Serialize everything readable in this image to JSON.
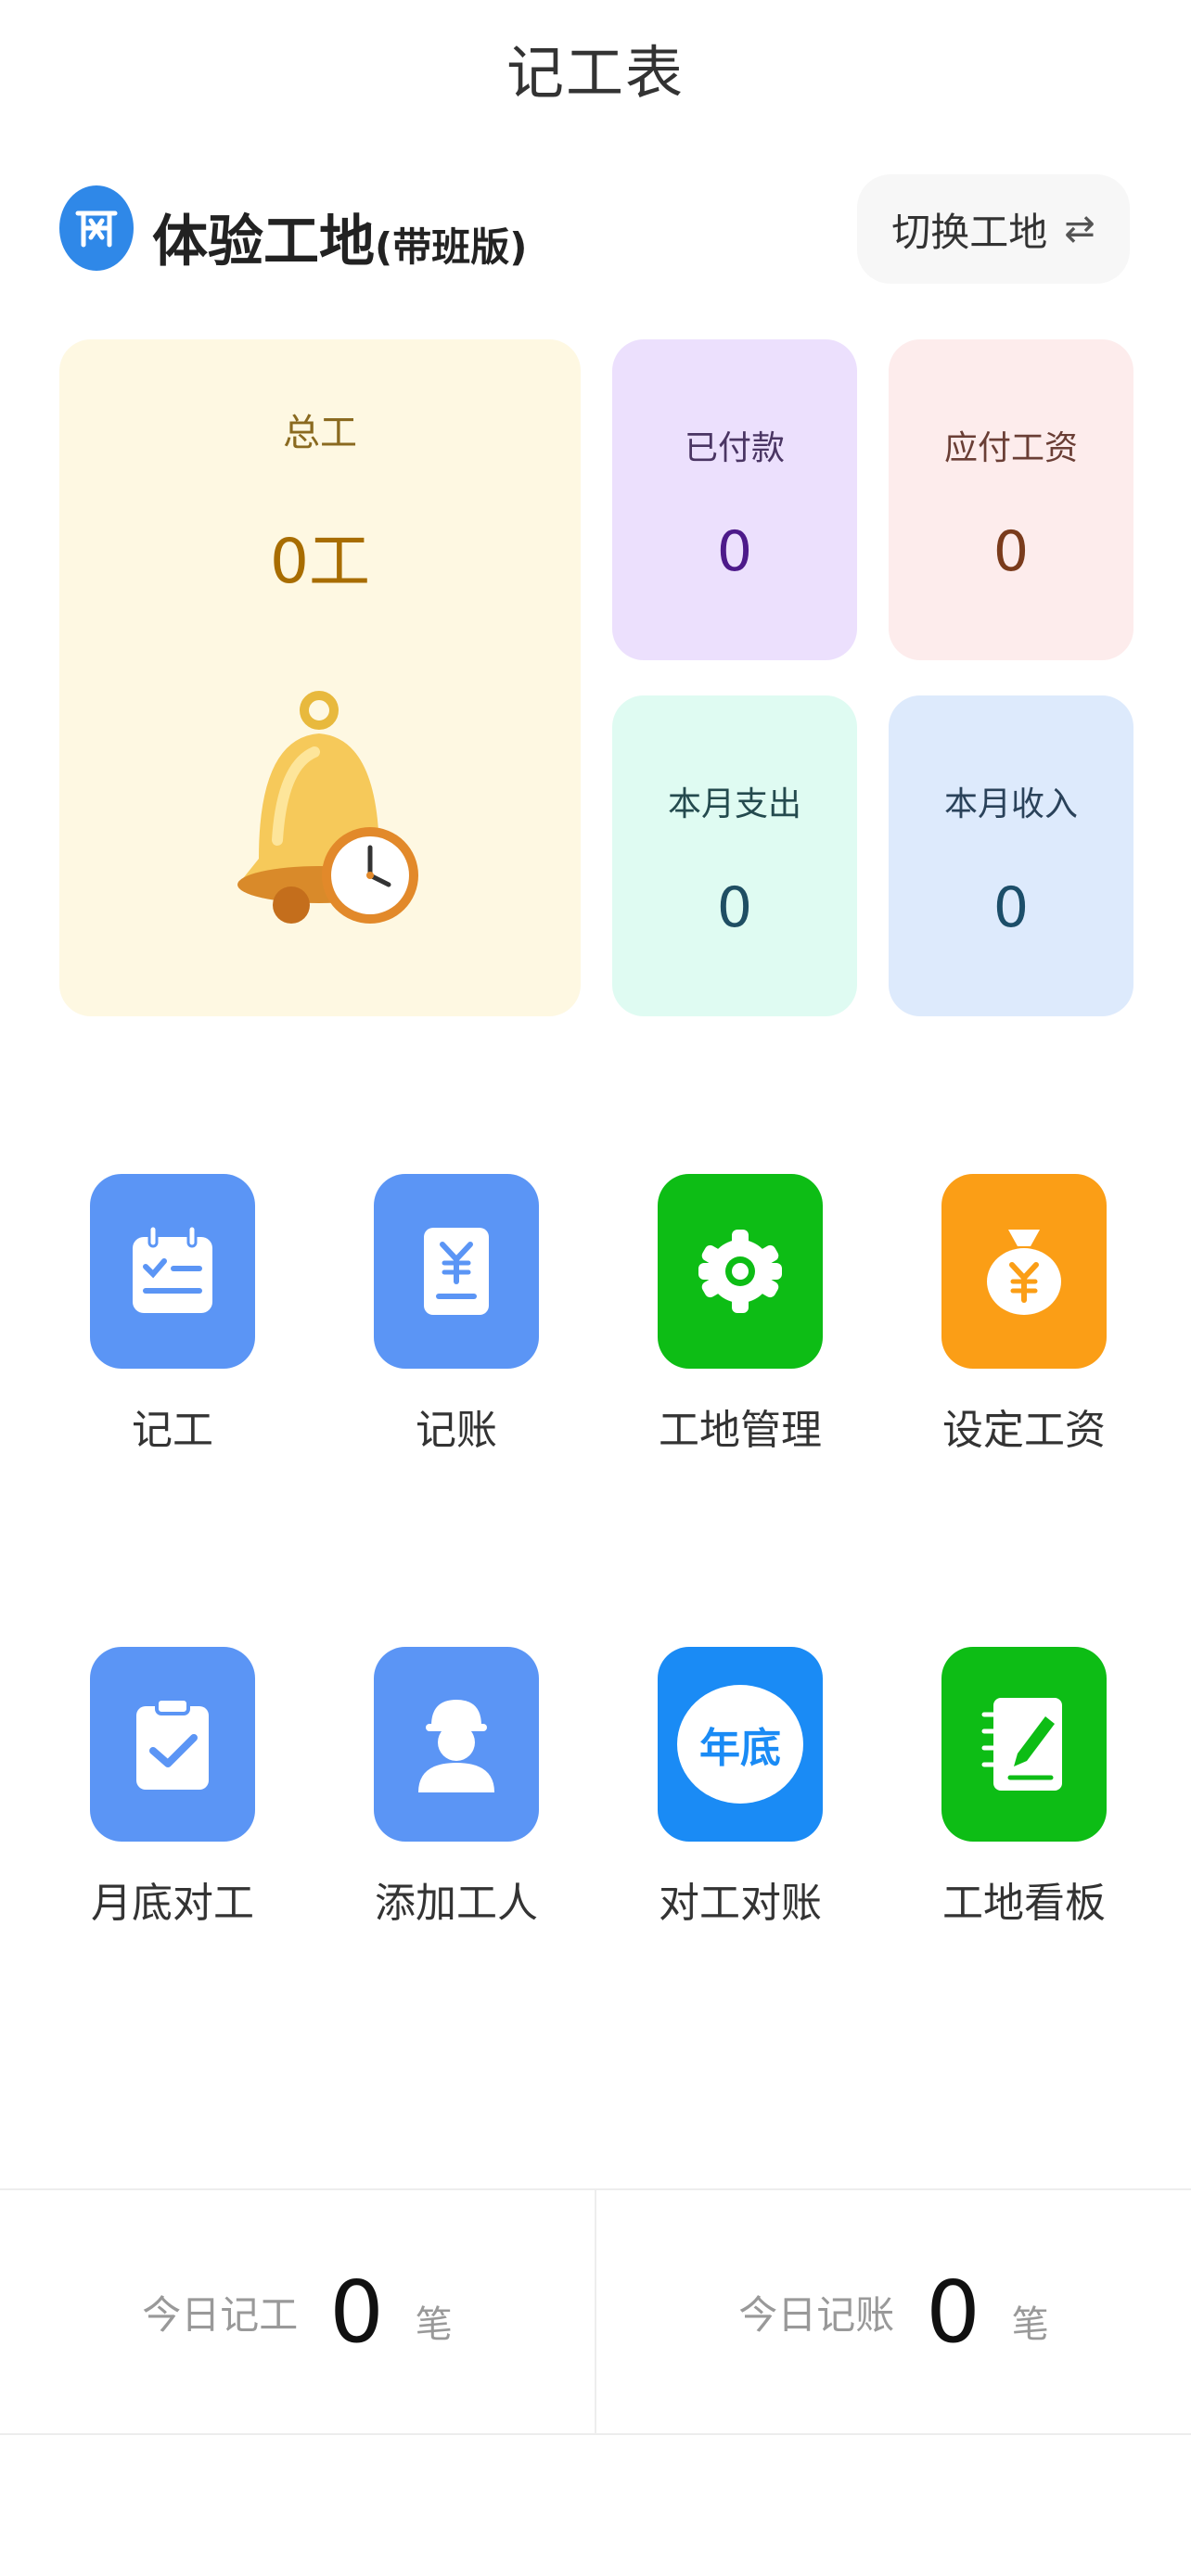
{
  "header": {
    "title": "记工表"
  },
  "site": {
    "name": "体验工地",
    "edition": "(带班版)",
    "switch_label": "切换工地",
    "switch_icon": "⇄"
  },
  "cards": {
    "total": {
      "label": "总工",
      "value": "0工"
    },
    "paid": {
      "label": "已付款",
      "value": "0"
    },
    "wage_due": {
      "label": "应付工资",
      "value": "0"
    },
    "month_expense": {
      "label": "本月支出",
      "value": "0"
    },
    "month_income": {
      "label": "本月收入",
      "value": "0"
    }
  },
  "menu": [
    {
      "label": "记工",
      "icon": "calendar-checklist-icon",
      "color": "#5b95f5"
    },
    {
      "label": "记账",
      "icon": "yen-receipt-icon",
      "color": "#5b95f5"
    },
    {
      "label": "工地管理",
      "icon": "gear-icon",
      "color": "#0dbd15"
    },
    {
      "label": "设定工资",
      "icon": "money-bag-icon",
      "color": "#fb9e16"
    },
    {
      "label": "月底对工",
      "icon": "clipboard-check-icon",
      "color": "#5b95f5"
    },
    {
      "label": "添加工人",
      "icon": "worker-icon",
      "color": "#5b95f5"
    },
    {
      "label": "对工对账",
      "icon": "year-end-bubble-icon",
      "color": "#1a8bf5",
      "icon_text": "年底"
    },
    {
      "label": "工地看板",
      "icon": "notebook-pen-icon",
      "color": "#0dbd15"
    }
  ],
  "stats": {
    "today_work": {
      "label": "今日记工",
      "value": "0",
      "unit": "笔"
    },
    "today_account": {
      "label": "今日记账",
      "value": "0",
      "unit": "笔"
    }
  }
}
